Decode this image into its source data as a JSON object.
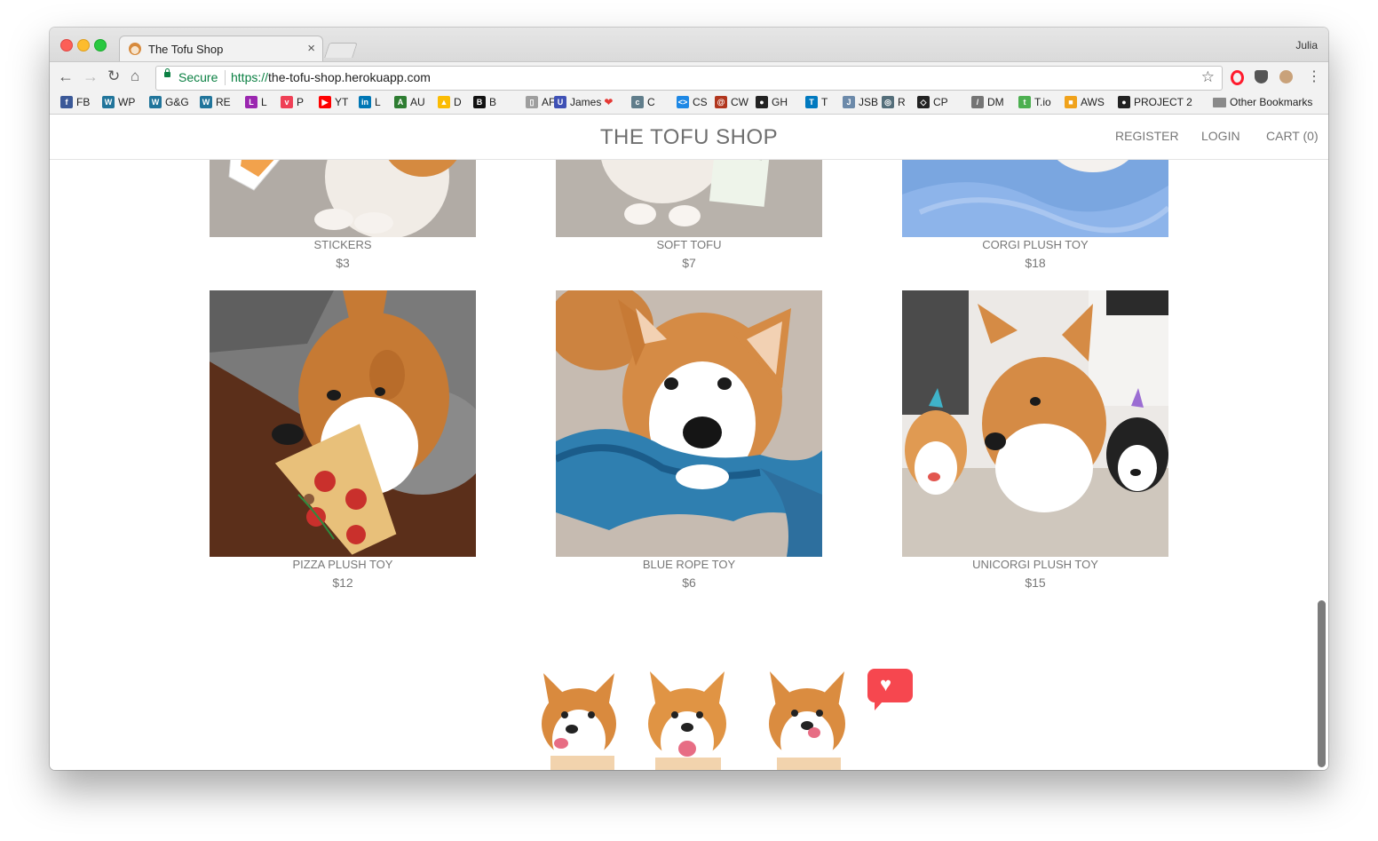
{
  "browser": {
    "tab_title": "The Tofu Shop",
    "profile_name": "Julia",
    "secure_label": "Secure",
    "url_scheme": "https://",
    "url_host": "the-tofu-shop.herokuapp.com",
    "bookmarks": [
      {
        "label": "FB",
        "icon": "facebook-icon",
        "color": "#3b5998",
        "glyph": "f"
      },
      {
        "label": "WP",
        "icon": "wordpress-icon",
        "color": "#21759b",
        "glyph": "W"
      },
      {
        "label": "G&G",
        "icon": "wordpress-icon",
        "color": "#21759b",
        "glyph": "W"
      },
      {
        "label": "RE",
        "icon": "wordpress-icon",
        "color": "#21759b",
        "glyph": "W"
      },
      {
        "label": "L",
        "icon": "letter-l-icon",
        "color": "#9b27b0",
        "glyph": "L"
      },
      {
        "label": "P",
        "icon": "pocket-icon",
        "color": "#ef4056",
        "glyph": "v"
      },
      {
        "label": "YT",
        "icon": "youtube-icon",
        "color": "#ff0000",
        "glyph": "▶"
      },
      {
        "label": "L",
        "icon": "linkedin-icon",
        "color": "#0077b5",
        "glyph": "in"
      },
      {
        "label": "AU",
        "icon": "au-icon",
        "color": "#2e7d32",
        "glyph": "A"
      },
      {
        "label": "D",
        "icon": "google-drive-icon",
        "color": "#fbbc04",
        "glyph": "▲"
      },
      {
        "label": "B",
        "icon": "b-icon",
        "color": "#111111",
        "glyph": "B"
      },
      {
        "label": "AF",
        "icon": "document-icon",
        "color": "#9e9e9e",
        "glyph": "▯"
      },
      {
        "label": "James",
        "icon": "u-icon",
        "color": "#3f51b5",
        "glyph": "U",
        "suffix": "❤"
      },
      {
        "label": "C",
        "icon": "c-icon",
        "color": "#607d8b",
        "glyph": "c"
      },
      {
        "label": "CS",
        "icon": "code-icon",
        "color": "#1e88e5",
        "glyph": "<>"
      },
      {
        "label": "CW",
        "icon": "codewars-icon",
        "color": "#b1361e",
        "glyph": "@"
      },
      {
        "label": "GH",
        "icon": "github-icon",
        "color": "#222222",
        "glyph": "●"
      },
      {
        "label": "T",
        "icon": "trello-icon",
        "color": "#0079bf",
        "glyph": "T"
      },
      {
        "label": "JSB",
        "icon": "jsbin-icon",
        "color": "#6c8aaa",
        "glyph": "J"
      },
      {
        "label": "R",
        "icon": "r-icon",
        "color": "#546e7a",
        "glyph": "◎"
      },
      {
        "label": "CP",
        "icon": "codepen-icon",
        "color": "#222222",
        "glyph": "◇"
      },
      {
        "label": "DM",
        "icon": "code-slash-icon",
        "color": "#757575",
        "glyph": "/"
      },
      {
        "label": "T.io",
        "icon": "tio-icon",
        "color": "#4caf50",
        "glyph": "t"
      },
      {
        "label": "AWS",
        "icon": "aws-icon",
        "color": "#f0a21b",
        "glyph": "■"
      },
      {
        "label": "PROJECT 2",
        "icon": "github-icon",
        "color": "#222222",
        "glyph": "●"
      }
    ],
    "other_bookmarks": "Other Bookmarks"
  },
  "site": {
    "title": "THE TOFU SHOP",
    "nav": {
      "register": "REGISTER",
      "login": "LOGIN",
      "cart": "CART (0)"
    }
  },
  "products": [
    {
      "name": "STICKERS",
      "price": "$3"
    },
    {
      "name": "SOFT TOFU",
      "price": "$7"
    },
    {
      "name": "CORGI PLUSH TOY",
      "price": "$18"
    },
    {
      "name": "PIZZA PLUSH TOY",
      "price": "$12"
    },
    {
      "name": "BLUE ROPE TOY",
      "price": "$6"
    },
    {
      "name": "UNICORGI PLUSH TOY",
      "price": "$15"
    }
  ],
  "colors": {
    "accent_heart": "#f6474f",
    "corgi_orange": "#d98a3e",
    "text_gray": "#777777"
  }
}
